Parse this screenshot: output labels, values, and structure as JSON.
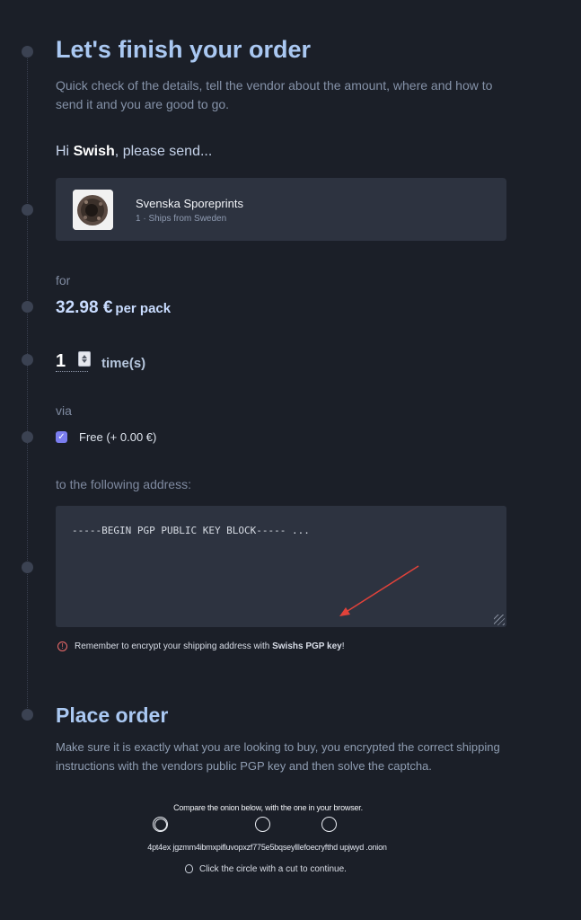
{
  "header": {
    "title": "Let's finish your order",
    "subtitle": "Quick check of the details, tell the vendor about the amount, where and how to send it and you are good to go."
  },
  "greeting": {
    "prefix": "Hi ",
    "name": "Swish",
    "suffix": ", please send..."
  },
  "product": {
    "name": "Svenska Sporeprints",
    "meta": "1 · Ships from Sweden"
  },
  "pricing": {
    "for_label": "for",
    "price": "32.98 €",
    "unit": "per pack"
  },
  "quantity": {
    "value": "1",
    "unit": "time(s)"
  },
  "shipping": {
    "via_label": "via",
    "selected_option": "Free (+ 0.00 €)"
  },
  "address": {
    "label": "to the following address:",
    "value": "-----BEGIN PGP PUBLIC KEY BLOCK----- ...",
    "warning_prefix": "Remember to encrypt your shipping address with ",
    "warning_key": "Swishs PGP key",
    "warning_suffix": "!"
  },
  "place_order": {
    "title": "Place order",
    "description": "Make sure it is exactly what you are looking to buy, you encrypted the correct shipping instructions with the vendors public PGP key and then solve the captcha."
  },
  "captcha": {
    "prompt": "Compare the onion below, with the one in your browser.",
    "onion_text": "4pt4ex  jgzmm4ibmxpifluvopxzf775e5bqseylllefoecryfthd  upjwyd   .onion",
    "hint": "Click the circle with a cut to continue."
  },
  "colors": {
    "background": "#1b1f28",
    "card": "#2d3340",
    "title": "#aac8f2",
    "accent_checkbox": "#7b7ef0",
    "warning": "#ee6b6b",
    "annotation_arrow": "#e2423a"
  },
  "icons": {
    "checkbox": "check-icon",
    "warning": "exclamation-circle-icon",
    "hint": "lightbulb-icon"
  }
}
